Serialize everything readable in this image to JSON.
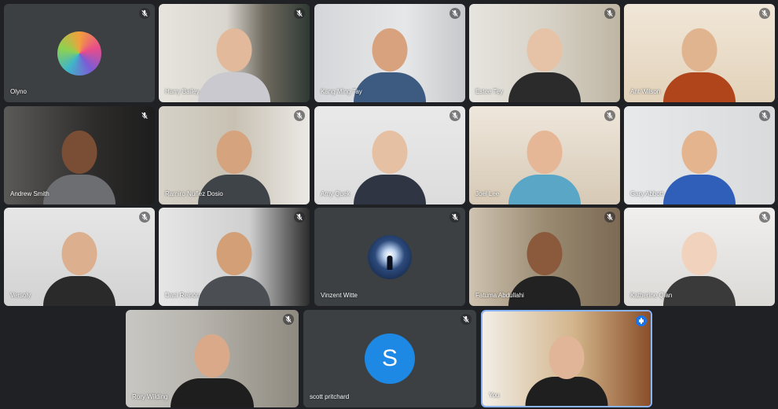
{
  "participants": [
    {
      "name": "Olyno",
      "avatar": "artwork",
      "muted": true
    },
    {
      "name": "Harry Bailey",
      "muted": true
    },
    {
      "name": "Kang Ming Tay",
      "muted": true
    },
    {
      "name": "Estee Tey",
      "muted": true
    },
    {
      "name": "Ant Wilson",
      "muted": true
    },
    {
      "name": "Andrew Smith",
      "muted": true
    },
    {
      "name": "Ramiro Nuñez Dosio",
      "muted": true
    },
    {
      "name": "Amy Quek",
      "muted": true
    },
    {
      "name": "Joel Lee",
      "muted": true
    },
    {
      "name": "Gary Abbott",
      "muted": true
    },
    {
      "name": "Versoly",
      "muted": true
    },
    {
      "name": "Dani Reinón",
      "muted": true
    },
    {
      "name": "Vinzent Witte",
      "avatar": "silhouette",
      "muted": true
    },
    {
      "name": "Fatuma Abdullahi",
      "muted": true
    },
    {
      "name": "Katherine Qian",
      "muted": true
    },
    {
      "name": "Rory Wilding",
      "muted": true
    },
    {
      "name": "scott pritchard",
      "avatar_letter": "S",
      "muted": true
    },
    {
      "name": "You",
      "muted": false,
      "speaking": true
    }
  ],
  "colors": {
    "background": "#202124",
    "tile": "#3c4043",
    "avatar_letter_bg": "#1e88e5",
    "speaking_border": "#8ab4f8"
  },
  "icons": {
    "muted": "mic-off-icon",
    "speaking": "audio-level-icon"
  }
}
